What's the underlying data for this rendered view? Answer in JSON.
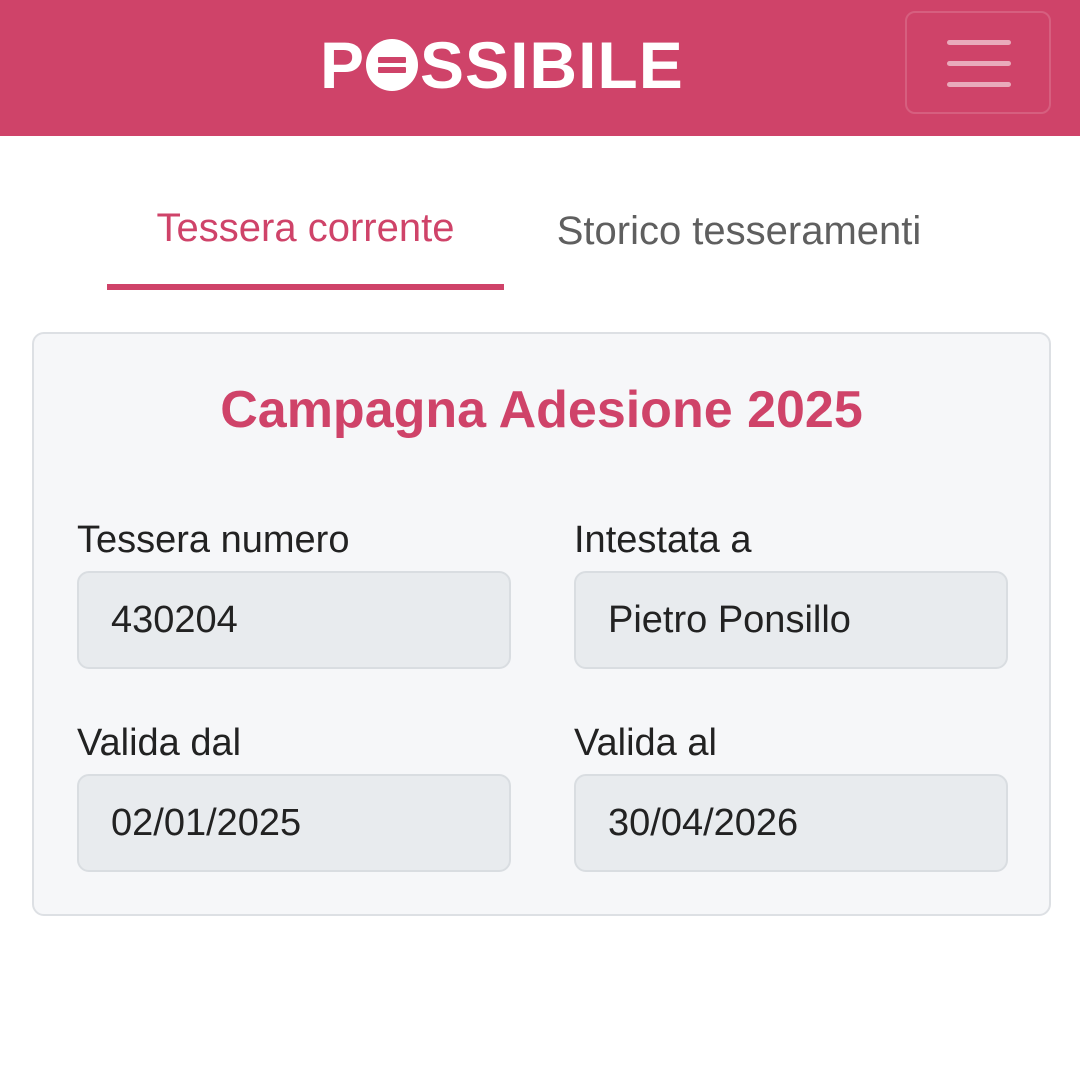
{
  "header": {
    "logo_text_start": "P",
    "logo_text_end": "SSIBILE",
    "brand_color": "#cf4369"
  },
  "tabs": [
    {
      "label": "Tessera corrente",
      "active": true
    },
    {
      "label": "Storico tesseramenti",
      "active": false
    }
  ],
  "card": {
    "title": "Campagna Adesione 2025",
    "fields": {
      "number": {
        "label": "Tessera numero",
        "value": "430204"
      },
      "holder": {
        "label": "Intestata a",
        "value": "Pietro Ponsillo"
      },
      "valid_from": {
        "label": "Valida dal",
        "value": "02/01/2025"
      },
      "valid_to": {
        "label": "Valida al",
        "value": "30/04/2026"
      }
    }
  }
}
